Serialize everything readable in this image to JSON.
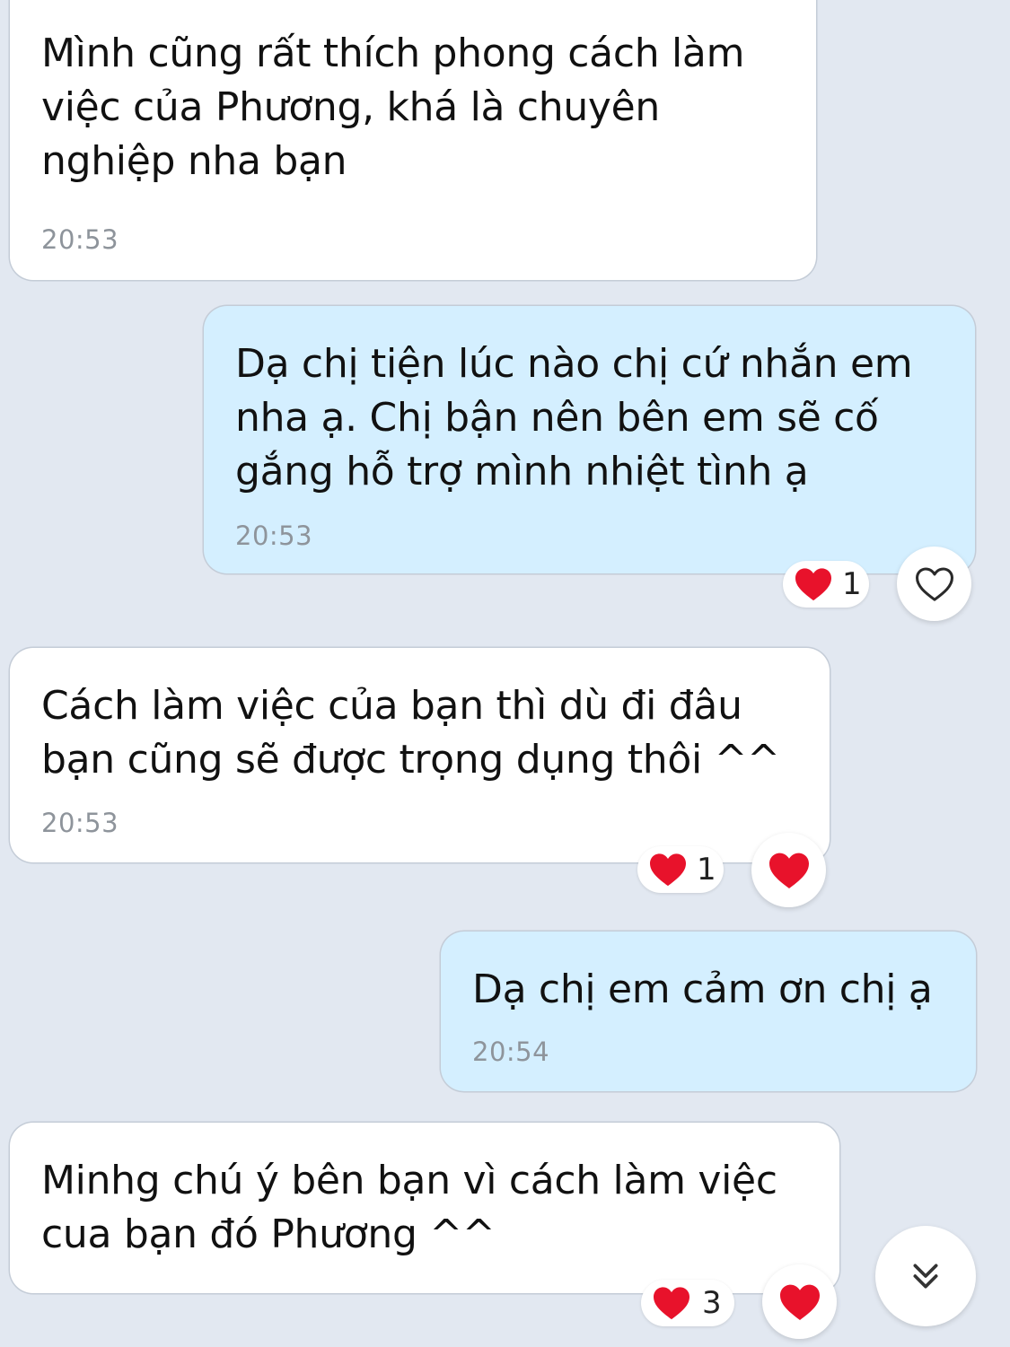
{
  "colors": {
    "background": "#e2e8f1",
    "incoming_bubble": "#ffffff",
    "outgoing_bubble": "#d4efff",
    "heart": "#e8122b",
    "timestamp": "#8e949b"
  },
  "messages": [
    {
      "direction": "incoming",
      "text": "Mình cũng rất thích phong cách làm\nviệc của Phương, khá là chuyên\nnghiệp nha bạn",
      "time": "20:53"
    },
    {
      "direction": "outgoing",
      "text": "Dạ chị tiện lúc nào chị cứ nhắn em\nnha ạ. Chị bận nên bên em sẽ cố\ngắng hỗ trợ mình nhiệt tình ạ",
      "time": "20:53",
      "reaction": {
        "icon": "heart-icon",
        "count": "1"
      },
      "react_button": {
        "icon": "heart-outline-icon",
        "active": false
      }
    },
    {
      "direction": "incoming",
      "text": "Cách làm việc của bạn thì dù đi đâu\nbạn cũng sẽ được trọng dụng thôi ^^",
      "time": "20:53",
      "reaction": {
        "icon": "heart-icon",
        "count": "1"
      },
      "react_button": {
        "icon": "heart-filled-icon",
        "active": true
      }
    },
    {
      "direction": "outgoing",
      "text": "Dạ chị em cảm ơn chị ạ",
      "time": "20:54"
    },
    {
      "direction": "incoming",
      "text": "Minhg chú ý bên bạn vì cách làm việc\ncua bạn đó Phương ^^",
      "reaction": {
        "icon": "heart-icon",
        "count": "3"
      },
      "react_button": {
        "icon": "heart-filled-icon",
        "active": true
      }
    }
  ],
  "scroll_down_button": {
    "icon": "chevron-double-down-icon"
  }
}
